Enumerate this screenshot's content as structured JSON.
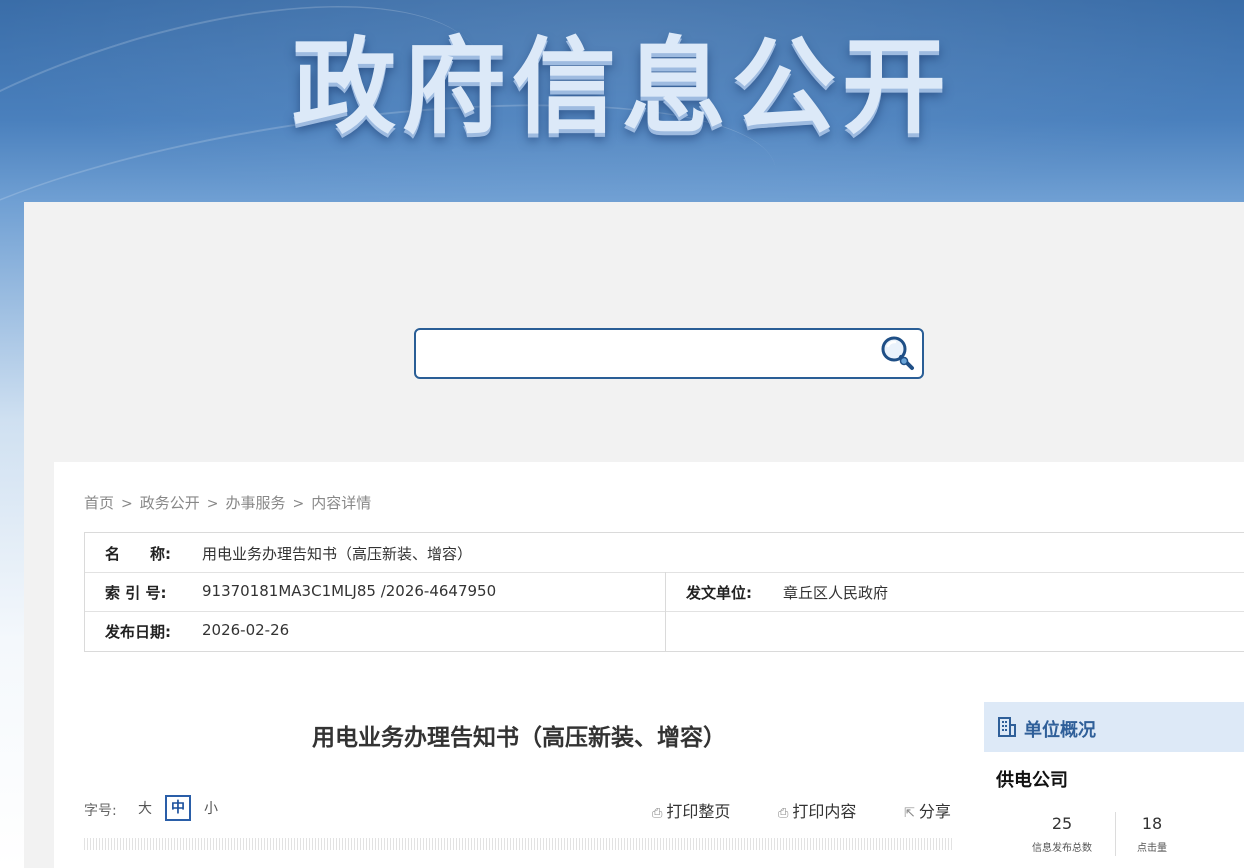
{
  "banner": {
    "title": "政府信息公开"
  },
  "search": {
    "value": "",
    "placeholder": ""
  },
  "breadcrumb": [
    "首页",
    "政务公开",
    "办事服务",
    "内容详情"
  ],
  "breadcrumb_separator": ">",
  "meta": {
    "name_label": "名　　称:",
    "name_value": "用电业务办理告知书（高压新装、增容）",
    "index_label": "索 引 号:",
    "index_value": "91370181MA3C1MLJ85 /2026-4647950",
    "issuer_label": "发文单位:",
    "issuer_value": "章丘区人民政府",
    "date_label": "发布日期:",
    "date_value": "2026-02-26"
  },
  "article": {
    "title": "用电业务办理告知书（高压新装、增容）"
  },
  "font_size": {
    "label": "字号:",
    "options": [
      "大",
      "中",
      "小"
    ],
    "selected": "中"
  },
  "tools": {
    "print_page": "打印整页",
    "print_content": "打印内容",
    "share": "分享"
  },
  "sidebar": {
    "title": "单位概况",
    "unit_name": "供电公司",
    "stats": [
      {
        "value": "25",
        "label": "信息发布总数"
      },
      {
        "value": "18",
        "label": "点击量"
      }
    ]
  },
  "colors": {
    "accent": "#2a5e96",
    "title_blue": "#2f5f99",
    "sidebar_head_bg": "#dde9f7"
  },
  "icons": [
    "search-icon",
    "printer-icon",
    "share-icon",
    "building-icon"
  ]
}
